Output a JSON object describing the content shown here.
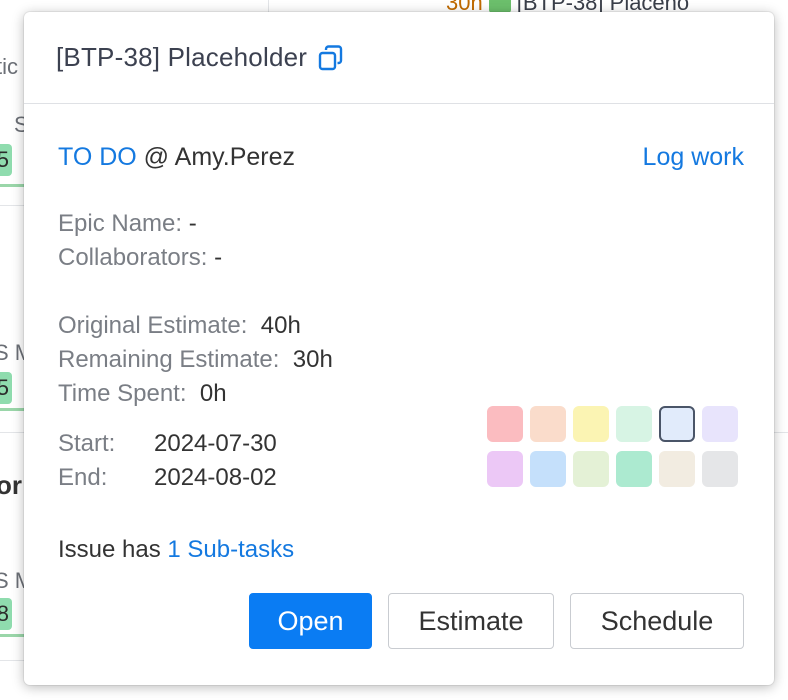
{
  "background": {
    "top_hours": "30h",
    "top_issue_title": "[BTP-38] Placeho",
    "fragments": [
      "tic",
      "S",
      "5",
      "S M",
      "5",
      "or",
      "S M",
      "8"
    ]
  },
  "popup": {
    "title": "[BTP-38] Placeholder",
    "status": "TO DO",
    "at_sign": "@",
    "assignee": "Amy.Perez",
    "log_work_label": "Log work",
    "epic_name_label": "Epic Name:",
    "epic_name_value": "-",
    "collaborators_label": "Collaborators:",
    "collaborators_value": "-",
    "original_estimate_label": "Original Estimate:",
    "original_estimate_value": "40h",
    "remaining_estimate_label": "Remaining Estimate:",
    "remaining_estimate_value": "30h",
    "time_spent_label": "Time Spent:",
    "time_spent_value": "0h",
    "start_label": "Start:",
    "start_value": "2024-07-30",
    "end_label": "End:",
    "end_value": "2024-08-02",
    "subtask_prefix": "Issue has",
    "subtask_link": "1 Sub-tasks",
    "buttons": {
      "open": "Open",
      "estimate": "Estimate",
      "schedule": "Schedule"
    }
  },
  "color_swatches": [
    "#fbbcc0",
    "#fadccb",
    "#fbf4b3",
    "#d7f4e4",
    "#e1ebfb",
    "#e8e4fc",
    "#ecc8f6",
    "#c5e0fb",
    "#e4f1d6",
    "#acead0",
    "#f2ece1",
    "#e5e6e8"
  ],
  "selected_swatch_index": 4,
  "colors": {
    "accent": "#0a7cf3",
    "link": "#1479e0"
  }
}
